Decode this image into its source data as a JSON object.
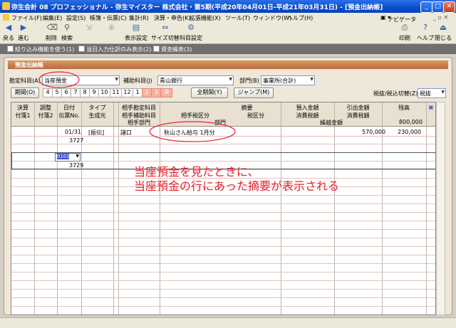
{
  "window": {
    "title": "弥生会計 08 プロフェッショナル - 弥生マイスター 株式会社・第5期(平成20年04月01日-平成21年03月31日) - [預金出納帳]",
    "min": "_",
    "max": "□",
    "close": "✕"
  },
  "menu": [
    "ファイル(F)",
    "編集(E)",
    "設定(S)",
    "帳簿・伝票(C)",
    "集計(R)",
    "決算・申告(K)",
    "拡張機能(X)",
    "ツール(T)",
    "ウィンドウ(W)",
    "ヘルプ(H)"
  ],
  "navigator": "ナビゲータ",
  "toolbar": {
    "back": "戻る",
    "forward": "進む",
    "delete": "削除",
    "search": "検索",
    "display_settings": "表示設定",
    "size_toggle": "サイズ切替",
    "account_settings": "科目設定",
    "print": "印刷",
    "help": "ヘルプ",
    "close": "閉じる"
  },
  "options": [
    "絞り込み機能を使う(1)",
    "当日入力仕訳のみ表示(2)",
    "資金繰表(3)"
  ],
  "panel_title": "預金出納帳",
  "filters": {
    "account_label": "勘定科目(A)",
    "account_value": "当座預金",
    "subaccount_label": "補助科目(J)",
    "subaccount_value": "青山銀行",
    "dept_label": "部門(B)",
    "dept_value": "事業所(合計)"
  },
  "period": {
    "period_btn": "期間(O)",
    "months": [
      "4",
      "5",
      "6",
      "7",
      "8",
      "9",
      "10",
      "11",
      "12",
      "1",
      "2",
      "3",
      "決"
    ],
    "full_period_btn": "全期間(Y)",
    "jump_btn": "ジャンプ(M)",
    "tax_label": "税抜/税込切替(Z)",
    "tax_value": "税抜"
  },
  "headers": {
    "r1": {
      "kessan": "決算",
      "chousei": "調整",
      "date": "日付",
      "type": "タイプ",
      "counter_account": "相手勘定科目",
      "memo": "摘要",
      "deposit": "預入金額",
      "withdraw": "引出金額",
      "balance": "残高"
    },
    "r2": {
      "tag1": "付箋1",
      "tag2": "付箋2",
      "slip_no": "伝票No.",
      "origin": "生成元",
      "counter_sub": "相手補助科目",
      "counter_tax": "相手税区分",
      "tax_class": "税区分",
      "tax1": "消費税額",
      "tax2": "消費税額"
    },
    "r3": {
      "counter_dept": "相手部門",
      "dept": "部門",
      "carryover": "繰越金額",
      "carryover_value": "800,000"
    }
  },
  "rows": [
    {
      "date": "01/31",
      "slip": "3727",
      "type": "[振伝]",
      "account": "諸口",
      "memo": "秋山さん給与 1月分",
      "deposit": "570,000",
      "withdraw": "230,000"
    }
  ],
  "entry": {
    "code": "0101",
    "slip": "3729"
  },
  "annotation": {
    "line1": "当座預金を見たときに、",
    "line2": "当座預金の行にあった摘要が表示される"
  },
  "colors": {
    "accent": "#b96a3a",
    "annotation": "#e8202a",
    "highlight": "#3a52c8"
  }
}
